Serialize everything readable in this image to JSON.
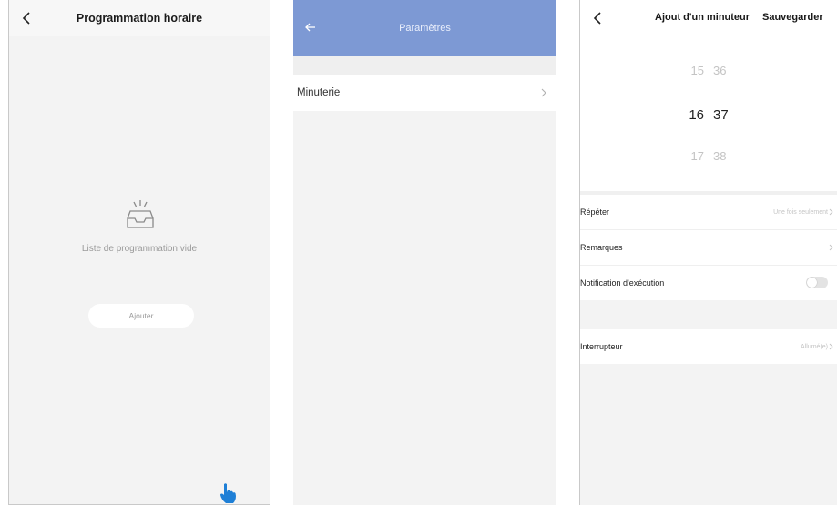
{
  "screen1": {
    "title": "Programmation horaire",
    "empty_message": "Liste de programmation vide",
    "add_button": "Ajouter",
    "icons": {
      "back": "chevron-left-icon",
      "empty": "empty-tray-icon"
    }
  },
  "screen2": {
    "title": "Paramètres",
    "menu_item": "Minuterie",
    "icons": {
      "back": "arrow-left-icon",
      "item": "chevron-right-icon"
    },
    "header_color": "#7d99d4"
  },
  "screen3": {
    "title": "Ajout d'un minuteur",
    "save": "Sauvegarder",
    "picker": {
      "prev": {
        "hour": "15",
        "minute": "36"
      },
      "current": {
        "hour": "16",
        "minute": "37"
      },
      "next": {
        "hour": "17",
        "minute": "38"
      }
    },
    "repeat_label": "Répéter",
    "repeat_value": "Une fois seulement",
    "notes_label": "Remarques",
    "notification_label": "Notification d'exécution",
    "notification_on": false,
    "switch_label": "Interrupteur",
    "switch_value": "Allumé(e)"
  },
  "cursor": {
    "icon": "pointing-hand-icon",
    "color": "#1e7fd6"
  }
}
